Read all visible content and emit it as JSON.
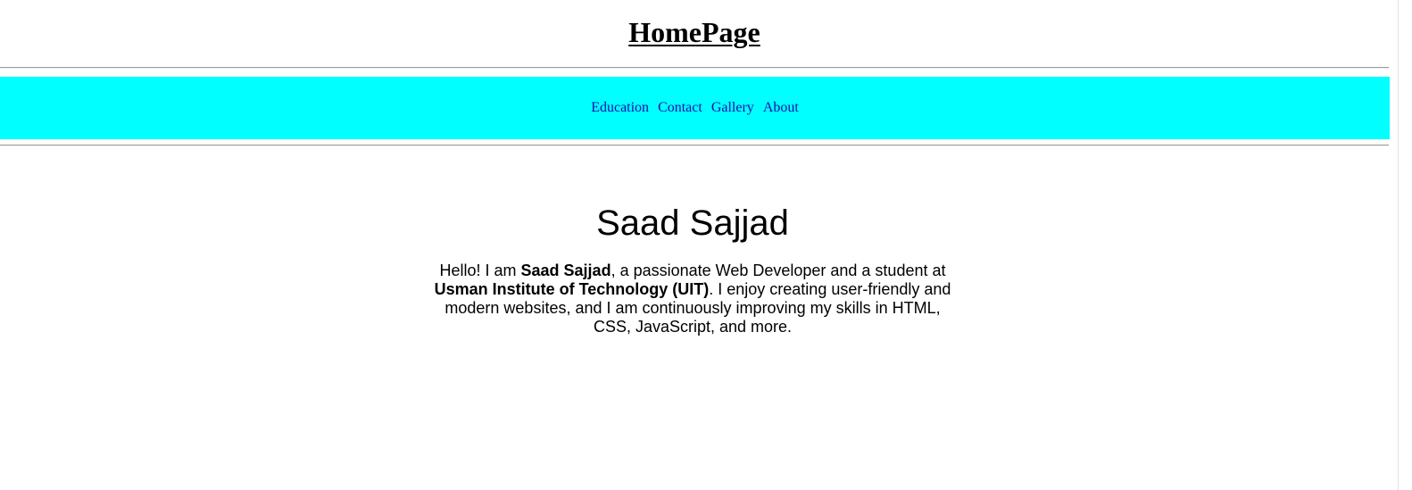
{
  "header": {
    "title": "HomePage"
  },
  "nav": {
    "background": "#00ffff",
    "link_color": "#1a0dab",
    "items": [
      {
        "label": "Education"
      },
      {
        "label": "Contact"
      },
      {
        "label": "Gallery"
      },
      {
        "label": "About"
      }
    ]
  },
  "hero": {
    "name": "Saad Sajjad",
    "bio": {
      "part1": "Hello! I am ",
      "name_bold": "Saad Sajjad",
      "part2": ", a passionate Web Developer and a student at ",
      "school_bold": "Usman Institute of Technology (UIT)",
      "part3": ". I enjoy creating user-friendly and modern websites, and I am continuously improving my skills in HTML, CSS, JavaScript, and more."
    }
  }
}
